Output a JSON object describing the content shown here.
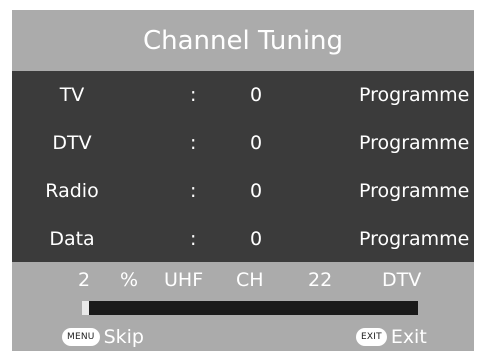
{
  "header": {
    "title": "Channel Tuning"
  },
  "rows": [
    {
      "name": "TV",
      "sep": ":",
      "count": "0",
      "unit": "Programme"
    },
    {
      "name": "DTV",
      "sep": ":",
      "count": "0",
      "unit": "Programme"
    },
    {
      "name": "Radio",
      "sep": ":",
      "count": "0",
      "unit": "Programme"
    },
    {
      "name": "Data",
      "sep": ":",
      "count": "0",
      "unit": "Programme"
    }
  ],
  "scan": {
    "percent_value": "2",
    "percent_sign": "%",
    "band": "UHF",
    "ch_label": "CH",
    "channel": "22",
    "mode": "DTV",
    "progress_fraction": 0.02
  },
  "footer": {
    "menu_key": "MENU",
    "menu_action": "Skip",
    "exit_key": "EXIT",
    "exit_action": "Exit"
  },
  "colors": {
    "header_bg": "#ababab",
    "body_bg": "#3b3b3b",
    "text": "#ffffff",
    "progress_track": "#1a1a1a"
  }
}
